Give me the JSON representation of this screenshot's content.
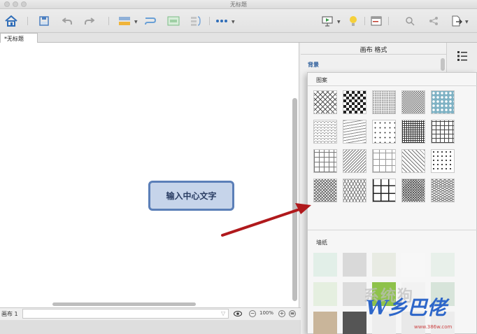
{
  "window": {
    "title": "无标题"
  },
  "toolbar": {
    "items": [
      "home-icon",
      "save-icon",
      "undo-icon",
      "redo-icon",
      "insert-topic-icon",
      "relationship-icon",
      "boundary-icon",
      "summary-icon",
      "more-icon",
      "presentation-icon",
      "idea-icon",
      "outline-icon",
      "search-icon",
      "share-icon",
      "export-icon"
    ]
  },
  "tabs": [
    {
      "label": "*无标题"
    }
  ],
  "canvas": {
    "central_topic": "输入中心文字"
  },
  "status": {
    "sheet_label": "画布 1",
    "zoom": "100%",
    "zoom_out": "−",
    "zoom_in": "+"
  },
  "panel": {
    "header": "画布 格式",
    "background_label": "背景"
  },
  "popup": {
    "patterns_label": "图案",
    "wallpaper_label": "墙纸",
    "pattern_names": [
      "diamond-lattice",
      "checkerboard",
      "fine-dots",
      "fine-check",
      "teal-ornament",
      "scale",
      "wave",
      "sparse-dots",
      "fine-grid-dark",
      "grid",
      "square-grid",
      "brick",
      "wide-grid",
      "diagonal",
      "polka-dots",
      "dense-hatch",
      "herringbone",
      "large-grid",
      "dense-dot",
      "crosshatch"
    ],
    "wallpaper_colors": [
      "#e2efe8",
      "#d9d9d9",
      "#e8ebe3",
      "#f7f7f7",
      "#e8f0ea",
      "#e5efe0",
      "#dcdcdc",
      "#8ec24a",
      "#f2f2f2",
      "#d7e4da",
      "#c9b59a",
      "#555555",
      "#ededed",
      "#e9e9e9",
      "#ececec"
    ]
  },
  "watermark": {
    "text": "系统狗",
    "logo": "W乡巴佬",
    "url": "www.386w.com"
  },
  "colors": {
    "accent": "#5b7fb8",
    "topic_fill": "#c6d4ea",
    "arrow": "#b0191c"
  }
}
